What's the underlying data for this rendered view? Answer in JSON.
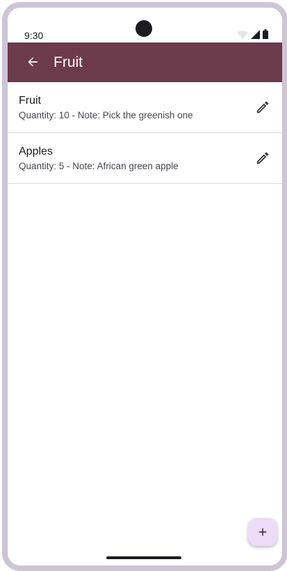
{
  "status_bar": {
    "time": "9:30",
    "icons": [
      "wifi-icon",
      "cellular-signal-icon",
      "battery-icon"
    ]
  },
  "app_bar": {
    "title": "Fruit",
    "back_icon": "arrow-back-icon",
    "color": "#6b3a4b"
  },
  "items": [
    {
      "title": "Fruit",
      "subtitle": "Quantity: 10 - Note: Pick the greenish one",
      "action_icon": "edit-pencil-icon"
    },
    {
      "title": "Apples",
      "subtitle": "Quantity: 5 - Note: African green apple",
      "action_icon": "edit-pencil-icon"
    }
  ],
  "fab": {
    "icon": "plus-icon",
    "color": "#ecdcf7"
  }
}
